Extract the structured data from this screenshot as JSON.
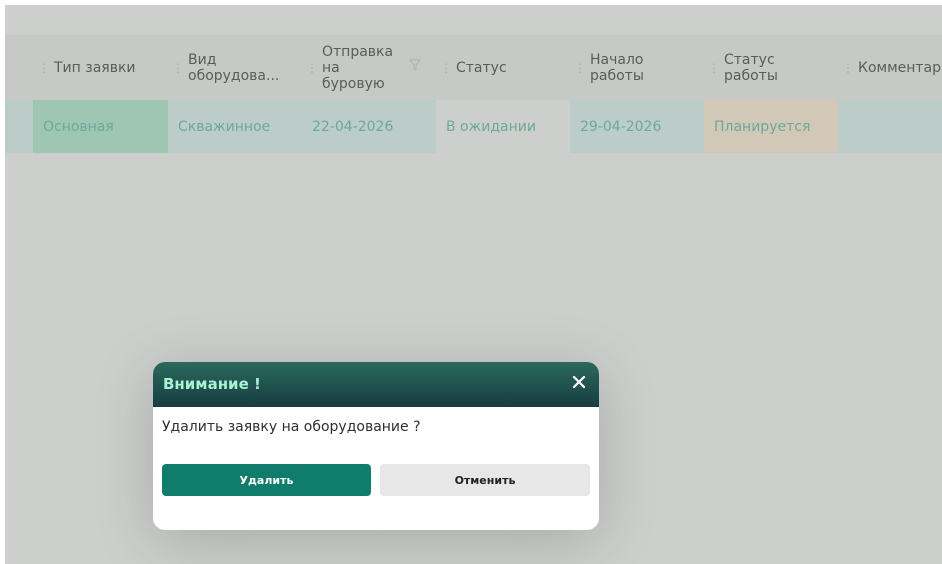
{
  "table": {
    "columns": [
      {
        "label": "Тип заявки"
      },
      {
        "label": "Вид\nоборудова..."
      },
      {
        "label": "Отправка\nна\nбуровую"
      },
      {
        "label": "Статус"
      },
      {
        "label": "Начало\nработы"
      },
      {
        "label": "Статус\nработы"
      },
      {
        "label": "Комментар.."
      }
    ],
    "rows": [
      {
        "cells": [
          {
            "value": "Основная",
            "highlight": "#a6e5c9"
          },
          {
            "value": "Скважинное",
            "highlight": "#d8efec"
          },
          {
            "value": "22-04-2026",
            "highlight": "#d8efec"
          },
          {
            "value": "В ожидании",
            "highlight": "#f5f5f5"
          },
          {
            "value": "29-04-2026",
            "highlight": "#d8efec"
          },
          {
            "value": "Планируется",
            "highlight": "#fbe9cf"
          },
          {
            "value": "",
            "highlight": "#d8efec"
          }
        ]
      }
    ]
  },
  "icons": {
    "column_grip": "column-resize-grip-icon",
    "filter": "filter-icon",
    "close": "close-icon"
  },
  "dialog": {
    "title": "Внимание !",
    "message": "Удалить заявку на оборудование ?",
    "confirm_label": "Удалить",
    "cancel_label": "Отменить"
  },
  "colors": {
    "accent": "#107d6c",
    "dialog_header_top": "#2a6a5d",
    "dialog_header_bottom": "#173c41",
    "dialog_title": "#a9f2d3",
    "row_text": "#4cb49c"
  }
}
